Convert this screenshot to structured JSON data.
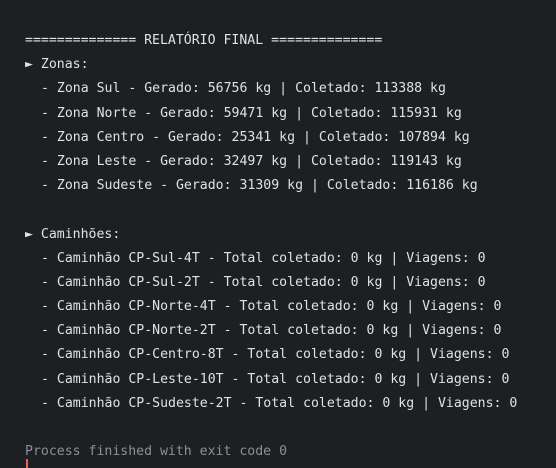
{
  "console": {
    "header": "============== RELATÓRIO FINAL ==============",
    "zonas": {
      "title": "► Zonas:",
      "items": [
        "- Zona Sul - Gerado: 56756 kg | Coletado: 113388 kg",
        "- Zona Norte - Gerado: 59471 kg | Coletado: 115931 kg",
        "- Zona Centro - Gerado: 25341 kg | Coletado: 107894 kg",
        "- Zona Leste - Gerado: 32497 kg | Coletado: 119143 kg",
        "- Zona Sudeste - Gerado: 31309 kg | Coletado: 116186 kg"
      ]
    },
    "caminhoes": {
      "title": "► Caminhões:",
      "items": [
        "- Caminhão CP-Sul-4T - Total coletado: 0 kg | Viagens: 0",
        "- Caminhão CP-Sul-2T - Total coletado: 0 kg | Viagens: 0",
        "- Caminhão CP-Norte-4T - Total coletado: 0 kg | Viagens: 0",
        "- Caminhão CP-Norte-2T - Total coletado: 0 kg | Viagens: 0",
        "- Caminhão CP-Centro-8T - Total coletado: 0 kg | Viagens: 0",
        "- Caminhão CP-Leste-10T - Total coletado: 0 kg | Viagens: 0",
        "- Caminhão CP-Sudeste-2T - Total coletado: 0 kg | Viagens: 0"
      ]
    },
    "exit_message": "Process finished with exit code 0"
  },
  "colors": {
    "background": "#1e1f22",
    "text": "#dfe1e5",
    "muted_text": "#8c8f96",
    "caret": "#e8654f"
  }
}
